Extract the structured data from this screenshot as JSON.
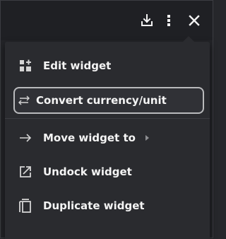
{
  "menu": {
    "items": [
      {
        "label": "Edit widget",
        "icon": "grid-plus-icon"
      },
      {
        "label": "Convert currency/unit",
        "icon": "swap-arrows-icon"
      },
      {
        "label": "Move widget to",
        "icon": "arrow-right-icon"
      },
      {
        "label": "Undock widget",
        "icon": "external-link-icon"
      },
      {
        "label": "Duplicate widget",
        "icon": "copy-icon"
      }
    ],
    "selected_index": 1
  },
  "topbar": {
    "icons": [
      "download-icon",
      "more-vertical-icon",
      "close-icon"
    ]
  },
  "colors": {
    "background": "#232428",
    "menu_background": "#2a2b2f",
    "text": "#f4f4f4",
    "selected_border": "#b9babc"
  }
}
